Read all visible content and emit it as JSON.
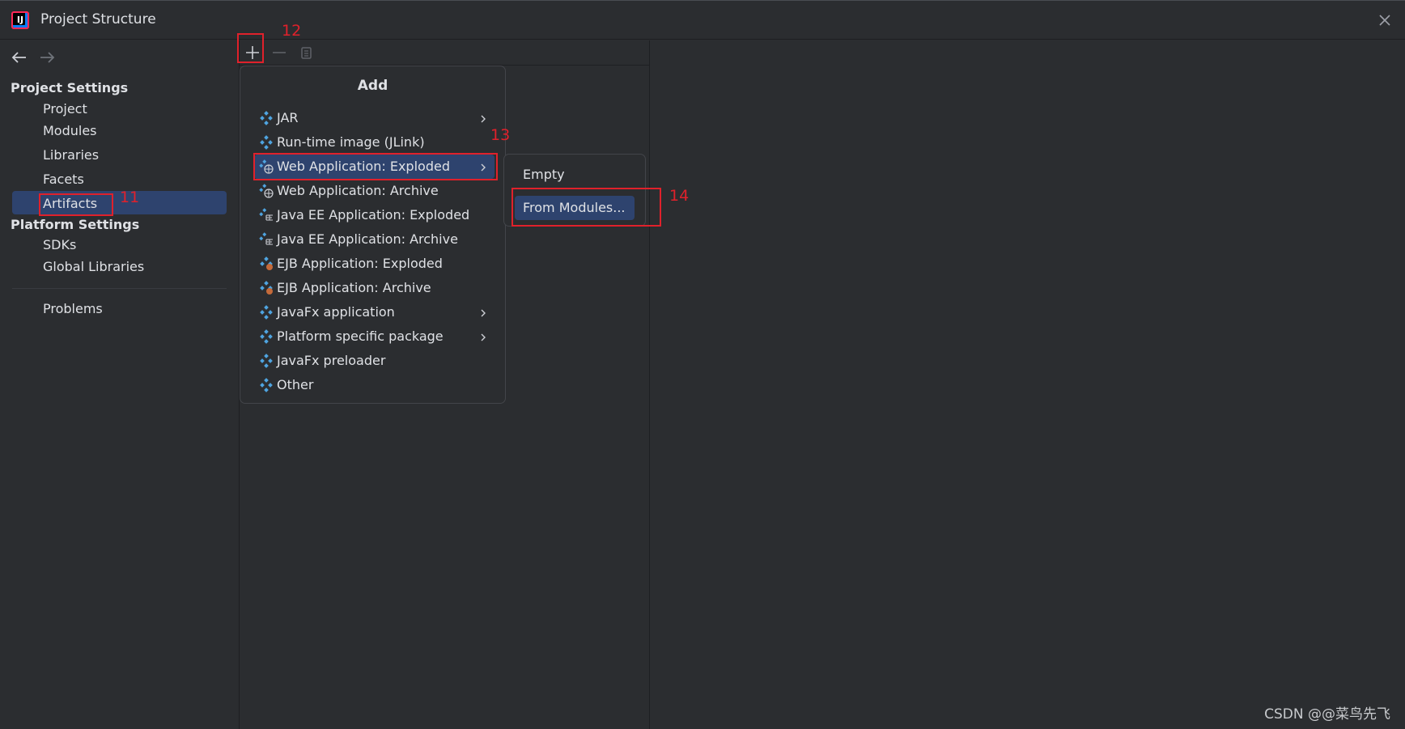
{
  "window": {
    "title": "Project Structure",
    "logo_text": "IJ"
  },
  "sidebar": {
    "project_settings_title": "Project Settings",
    "project_items": [
      "Project",
      "Modules",
      "Libraries",
      "Facets",
      "Artifacts"
    ],
    "selected": "Artifacts",
    "platform_settings_title": "Platform Settings",
    "platform_items": [
      "SDKs",
      "Global Libraries"
    ],
    "problems": "Problems"
  },
  "toolbar": {
    "add_icon": "plus-icon",
    "remove_icon": "minus-icon",
    "copy_icon": "copy-icon"
  },
  "add_menu": {
    "title": "Add",
    "items": [
      {
        "label": "JAR",
        "icon": "artifact-icon",
        "has_submenu": true
      },
      {
        "label": "Run-time image (JLink)",
        "icon": "artifact-icon",
        "has_submenu": false
      },
      {
        "label": "Web Application: Exploded",
        "icon": "web-app-icon",
        "has_submenu": true,
        "active": true
      },
      {
        "label": "Web Application: Archive",
        "icon": "web-app-icon",
        "has_submenu": false
      },
      {
        "label": "Java EE Application: Exploded",
        "icon": "javaee-icon",
        "has_submenu": false
      },
      {
        "label": "Java EE Application: Archive",
        "icon": "javaee-icon",
        "has_submenu": false
      },
      {
        "label": "EJB Application: Exploded",
        "icon": "ejb-icon",
        "has_submenu": false
      },
      {
        "label": "EJB Application: Archive",
        "icon": "ejb-icon",
        "has_submenu": false
      },
      {
        "label": "JavaFx application",
        "icon": "artifact-icon",
        "has_submenu": true
      },
      {
        "label": "Platform specific package",
        "icon": "artifact-icon",
        "has_submenu": true
      },
      {
        "label": "JavaFx preloader",
        "icon": "artifact-icon",
        "has_submenu": false
      },
      {
        "label": "Other",
        "icon": "artifact-icon",
        "has_submenu": false
      }
    ]
  },
  "submenu": {
    "items": [
      {
        "label": "Empty",
        "active": false
      },
      {
        "label": "From Modules...",
        "active": true
      }
    ]
  },
  "annotations": [
    "11",
    "12",
    "13",
    "14"
  ],
  "watermark": "CSDN @@菜鸟先飞",
  "colors": {
    "background": "#2b2d30",
    "selection": "#2e436e",
    "annotation": "#e0212b",
    "text": "#dfe1e5"
  }
}
